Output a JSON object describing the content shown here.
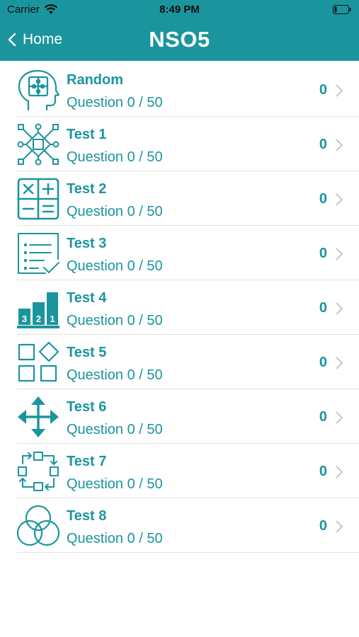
{
  "status_bar": {
    "carrier": "Carrier",
    "time": "8:49 PM"
  },
  "nav": {
    "back_label": "Home",
    "title": "NSO5"
  },
  "colors": {
    "accent": "#1b959d",
    "background": "#ffffff",
    "divider": "#e3e3e3",
    "chevron": "#c7c7cc"
  },
  "items": [
    {
      "name": "Random",
      "progress": "Question 0 / 50",
      "score": "0",
      "icon": "head-puzzle-icon"
    },
    {
      "name": "Test 1",
      "progress": "Question 0 / 50",
      "score": "0",
      "icon": "network-nodes-icon"
    },
    {
      "name": "Test 2",
      "progress": "Question 0 / 50",
      "score": "0",
      "icon": "calculator-icon"
    },
    {
      "name": "Test 3",
      "progress": "Question 0 / 50",
      "score": "0",
      "icon": "checklist-icon"
    },
    {
      "name": "Test 4",
      "progress": "Question 0 / 50",
      "score": "0",
      "icon": "podium-icon",
      "podium_labels": [
        "3",
        "2",
        "1"
      ]
    },
    {
      "name": "Test 5",
      "progress": "Question 0 / 50",
      "score": "0",
      "icon": "shapes-icon"
    },
    {
      "name": "Test 6",
      "progress": "Question 0 / 50",
      "score": "0",
      "icon": "move-arrows-icon"
    },
    {
      "name": "Test 7",
      "progress": "Question 0 / 50",
      "score": "0",
      "icon": "cycle-icon"
    },
    {
      "name": "Test 8",
      "progress": "Question 0 / 50",
      "score": "0",
      "icon": "venn-diagram-icon"
    }
  ]
}
